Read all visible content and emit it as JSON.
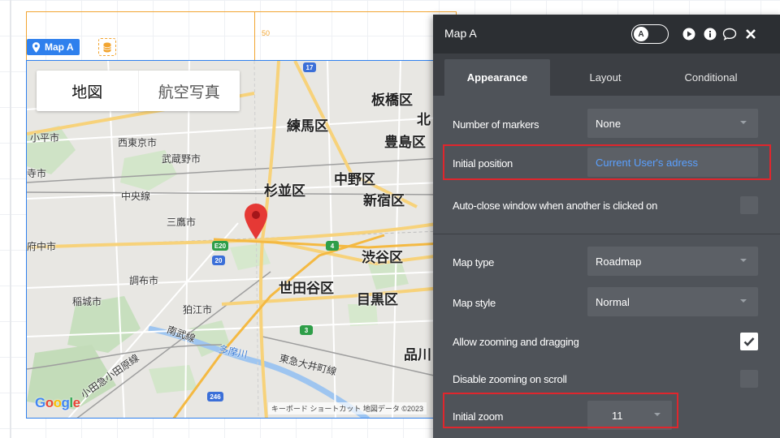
{
  "canvas": {
    "ruler_value": "50",
    "element_tag": "Map A"
  },
  "map": {
    "type_buttons": {
      "map": "地図",
      "satellite": "航空写真"
    },
    "labels": {
      "itabashi": "板橋区",
      "kita": "北",
      "nerima": "練馬区",
      "toshima": "豊島区",
      "kodaira": "小平市",
      "nishitokyo": "西東京市",
      "musashino": "武蔵野市",
      "kokubunji": "寺市",
      "nakano": "中野区",
      "suginami": "杉並区",
      "shinjuku": "新宿区",
      "chuo_line": "中央線",
      "mitaka": "三鷹市",
      "fuchu": "府中市",
      "shibuya": "渋谷区",
      "chofu": "調布市",
      "setagaya": "世田谷区",
      "meguro": "目黒区",
      "inagi": "稲城市",
      "komae": "狛江市",
      "nambu": "南武線",
      "tamagawa": "多摩川",
      "shinagawa": "品川",
      "odakyu": "小田急小田原線",
      "denentoshi": "東急大井町線"
    },
    "shields": {
      "r17": "17",
      "r4": "4",
      "r20": "20",
      "e20": "E20",
      "r3": "3",
      "r246": "246"
    },
    "google_logo": "Google",
    "attribution": "キーボード ショートカット  地図データ ©2023"
  },
  "panel": {
    "title": "Map A",
    "toggle_letter": "A",
    "tabs": [
      "Appearance",
      "Layout",
      "Conditional"
    ],
    "rows": {
      "markers_label": "Number of markers",
      "markers_value": "None",
      "initial_position_label": "Initial position",
      "initial_position_value": "Current User's adress",
      "auto_close_label": "Auto-close window when another is clicked on",
      "map_type_label": "Map type",
      "map_type_value": "Roadmap",
      "map_style_label": "Map style",
      "map_style_value": "Normal",
      "allow_zoom_label": "Allow zooming and dragging",
      "allow_zoom_checked": true,
      "disable_scroll_label": "Disable zooming on scroll",
      "disable_scroll_checked": false,
      "initial_zoom_label": "Initial zoom",
      "initial_zoom_value": "11"
    }
  },
  "colors": {
    "accent_blue": "#2f80ed",
    "group_orange": "#f2a531",
    "highlight_red": "#e0262d",
    "panel_bg": "#4f5359",
    "panel_header": "#2c2f33",
    "link_blue": "#5aa0ff",
    "marker_red": "#e53935"
  }
}
